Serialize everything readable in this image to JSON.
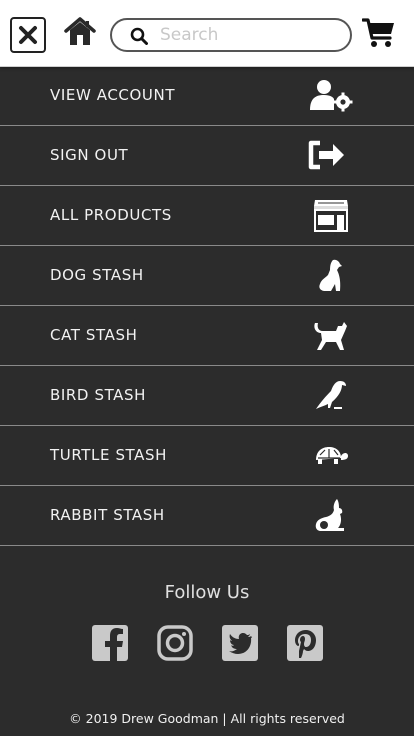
{
  "header": {
    "close_icon": "close-icon",
    "home_icon": "home-icon",
    "search": {
      "placeholder": "Search",
      "value": "",
      "icon": "search-icon"
    },
    "cart_icon": "cart-icon"
  },
  "menu": {
    "items": [
      {
        "label": "VIEW ACCOUNT",
        "icon": "user-settings-icon"
      },
      {
        "label": "SIGN OUT",
        "icon": "sign-out-icon"
      },
      {
        "label": "ALL PRODUCTS",
        "icon": "store-icon"
      },
      {
        "label": "DOG STASH",
        "icon": "dog-icon"
      },
      {
        "label": "CAT STASH",
        "icon": "cat-icon"
      },
      {
        "label": "BIRD STASH",
        "icon": "bird-icon"
      },
      {
        "label": "TURTLE STASH",
        "icon": "turtle-icon"
      },
      {
        "label": "RABBIT STASH",
        "icon": "rabbit-icon"
      }
    ]
  },
  "footer": {
    "follow_title": "Follow Us",
    "socials": [
      {
        "icon": "facebook-icon"
      },
      {
        "icon": "instagram-icon"
      },
      {
        "icon": "twitter-icon"
      },
      {
        "icon": "pinterest-icon"
      }
    ],
    "copyright": "© 2019 Drew Goodman | All rights reserved"
  },
  "colors": {
    "menu_bg": "#2c2c2c",
    "divider": "#8a8a8a",
    "menu_text": "#f2f2f2",
    "social_icon": "#c9c9c9",
    "header_bg": "#ffffff"
  }
}
